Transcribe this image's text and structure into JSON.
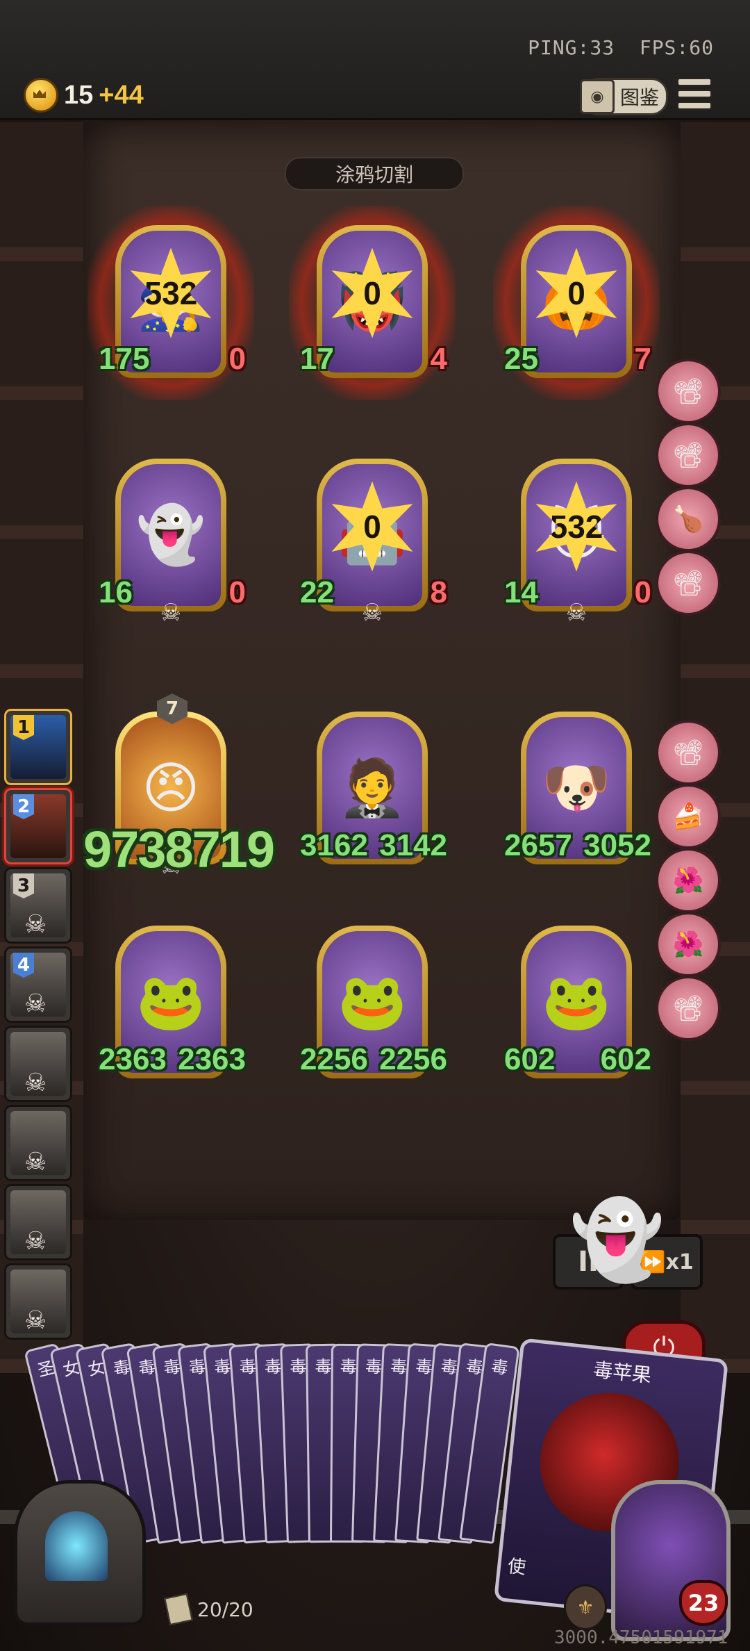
{
  "status": {
    "ping": "PING:33",
    "fps": "FPS:60"
  },
  "gold": {
    "value": "15",
    "increment": "+44"
  },
  "codex": {
    "label": "图鉴"
  },
  "board": {
    "title": "涂鸦切割"
  },
  "units": [
    {
      "row": 1,
      "col": 1,
      "star": "532",
      "atk": "175",
      "hp": "0",
      "burning": true
    },
    {
      "row": 1,
      "col": 2,
      "star": "0",
      "atk": "17",
      "hp": "4",
      "burning": true
    },
    {
      "row": 1,
      "col": 3,
      "star": "0",
      "atk": "25",
      "hp": "7",
      "burning": true
    },
    {
      "row": 2,
      "col": 1,
      "star": "",
      "atk": "16",
      "hp": "0"
    },
    {
      "row": 2,
      "col": 2,
      "star": "0",
      "atk": "22",
      "hp": "8"
    },
    {
      "row": 2,
      "col": 3,
      "star": "532",
      "atk": "14",
      "hp": "0"
    },
    {
      "row": 3,
      "col": 1,
      "level": "7",
      "atk": "",
      "hp": ""
    },
    {
      "row": 3,
      "col": 2,
      "atk": "3162",
      "hp": "3142"
    },
    {
      "row": 3,
      "col": 3,
      "atk": "2657",
      "hp": "3052"
    },
    {
      "row": 4,
      "col": 1,
      "atk": "2363",
      "hp": "2363"
    },
    {
      "row": 4,
      "col": 2,
      "atk": "2256",
      "hp": "2256"
    },
    {
      "row": 4,
      "col": 3,
      "atk": "602",
      "hp": "602"
    }
  ],
  "damage_popup": "9738719",
  "sidebar": [
    {
      "num": "1"
    },
    {
      "num": "2"
    },
    {
      "num": "3"
    },
    {
      "num": "4"
    },
    {
      "num": ""
    },
    {
      "num": ""
    },
    {
      "num": ""
    },
    {
      "num": ""
    }
  ],
  "controls": {
    "pause": "II",
    "speed": "x1"
  },
  "hand": {
    "cards": [
      "圣",
      "女",
      "女",
      "毒",
      "毒",
      "毒",
      "毒",
      "毒",
      "毒",
      "毒",
      "毒",
      "毒",
      "毒",
      "毒",
      "毒",
      "毒",
      "毒",
      "毒",
      "毒"
    ],
    "featured": "毒苹果",
    "featured_partial": "使"
  },
  "deck": {
    "count": "20/20"
  },
  "hero": {
    "hp": "23"
  },
  "coords": "3000.47501591971"
}
